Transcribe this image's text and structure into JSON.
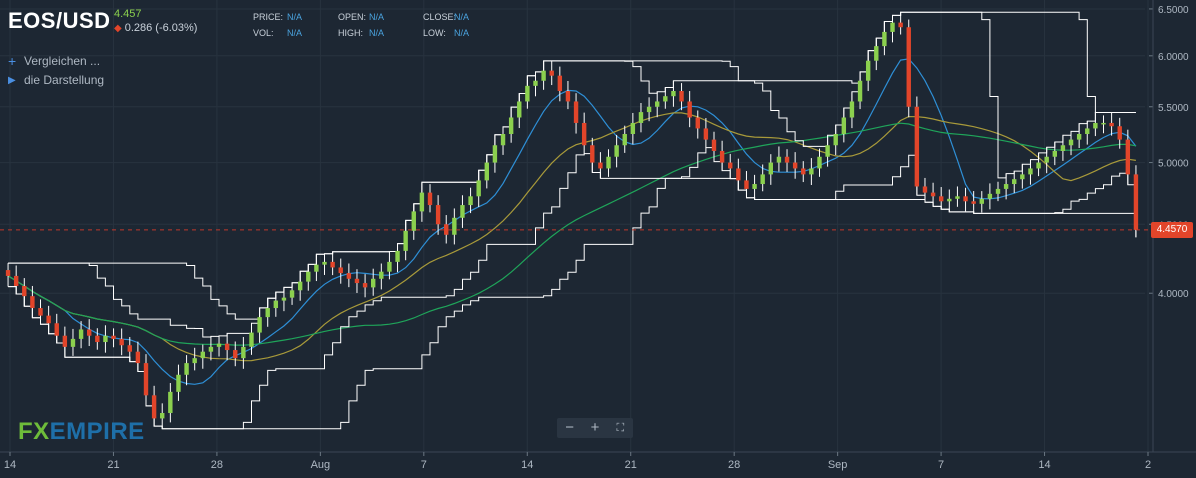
{
  "header": {
    "symbol": "EOS/USD",
    "last": "4.457",
    "change": "0.286 (-6.03%)",
    "stats": [
      {
        "label": "PRICE:",
        "value": "N/A"
      },
      {
        "label": "OPEN:",
        "value": "N/A"
      },
      {
        "label": "CLOSE:",
        "value": "N/A"
      },
      {
        "label": "VOL:",
        "value": "N/A"
      },
      {
        "label": "HIGH:",
        "value": "N/A"
      },
      {
        "label": "LOW:",
        "value": "N/A"
      }
    ]
  },
  "menu": {
    "compare": "Vergleichen ...",
    "display": "die Darstellung"
  },
  "price_tag": "4.4570",
  "logo": {
    "part1": "FX",
    "part2": "EMPIRE"
  },
  "colors": {
    "background": "#1d2733",
    "up": "#8bd04e",
    "down": "#e2452a",
    "band": "#ffffff",
    "ma_fast": "#2e8fd6",
    "ma_mid": "#a89a3a",
    "ma_slow": "#1fa55a"
  },
  "chart_data": {
    "type": "candlestick",
    "x_ticks": [
      "14",
      "21",
      "28",
      "Aug",
      "7",
      "14",
      "21",
      "28",
      "Sep",
      "7",
      "14",
      "2"
    ],
    "y_ticks": [
      6.5,
      6.0,
      5.5,
      5.0,
      4.5,
      4.0
    ],
    "y_scale": "log",
    "ylim": [
      3.05,
      6.6
    ],
    "last_price": 4.457,
    "grid": true,
    "series": [
      {
        "name": "",
        "kind": "close",
        "values": [
          4.12,
          4.05,
          3.98,
          3.9,
          3.85,
          3.8,
          3.72,
          3.65,
          3.7,
          3.76,
          3.72,
          3.68,
          3.72,
          3.7,
          3.66,
          3.62,
          3.55,
          3.36,
          3.23,
          3.26,
          3.38,
          3.48,
          3.55,
          3.58,
          3.62,
          3.65,
          3.67,
          3.63,
          3.58,
          3.65,
          3.74,
          3.84,
          3.9,
          3.95,
          3.97,
          4.02,
          4.08,
          4.15,
          4.2,
          4.22,
          4.18,
          4.14,
          4.1,
          4.07,
          4.04,
          4.1,
          4.15,
          4.22,
          4.3,
          4.45,
          4.6,
          4.75,
          4.65,
          4.5,
          4.42,
          4.55,
          4.65,
          4.72,
          4.85,
          5.0,
          5.15,
          5.25,
          5.4,
          5.55,
          5.7,
          5.75,
          5.85,
          5.8,
          5.65,
          5.55,
          5.35,
          5.15,
          5.0,
          4.95,
          5.05,
          5.15,
          5.25,
          5.35,
          5.45,
          5.5,
          5.55,
          5.6,
          5.65,
          5.55,
          5.4,
          5.3,
          5.2,
          5.1,
          5.0,
          4.95,
          4.85,
          4.78,
          4.82,
          4.9,
          5.0,
          5.05,
          5.0,
          4.95,
          4.9,
          4.95,
          5.05,
          5.15,
          5.25,
          5.4,
          5.55,
          5.75,
          5.95,
          6.1,
          6.25,
          6.35,
          6.3,
          5.5,
          4.8,
          4.75,
          4.72,
          4.68,
          4.7,
          4.72,
          4.68,
          4.66,
          4.7,
          4.74,
          4.78,
          4.82,
          4.86,
          4.9,
          4.95,
          5.0,
          5.05,
          5.1,
          5.15,
          5.2,
          5.25,
          5.3,
          5.35,
          5.35,
          5.32,
          5.2,
          4.9,
          4.457
        ]
      }
    ]
  }
}
